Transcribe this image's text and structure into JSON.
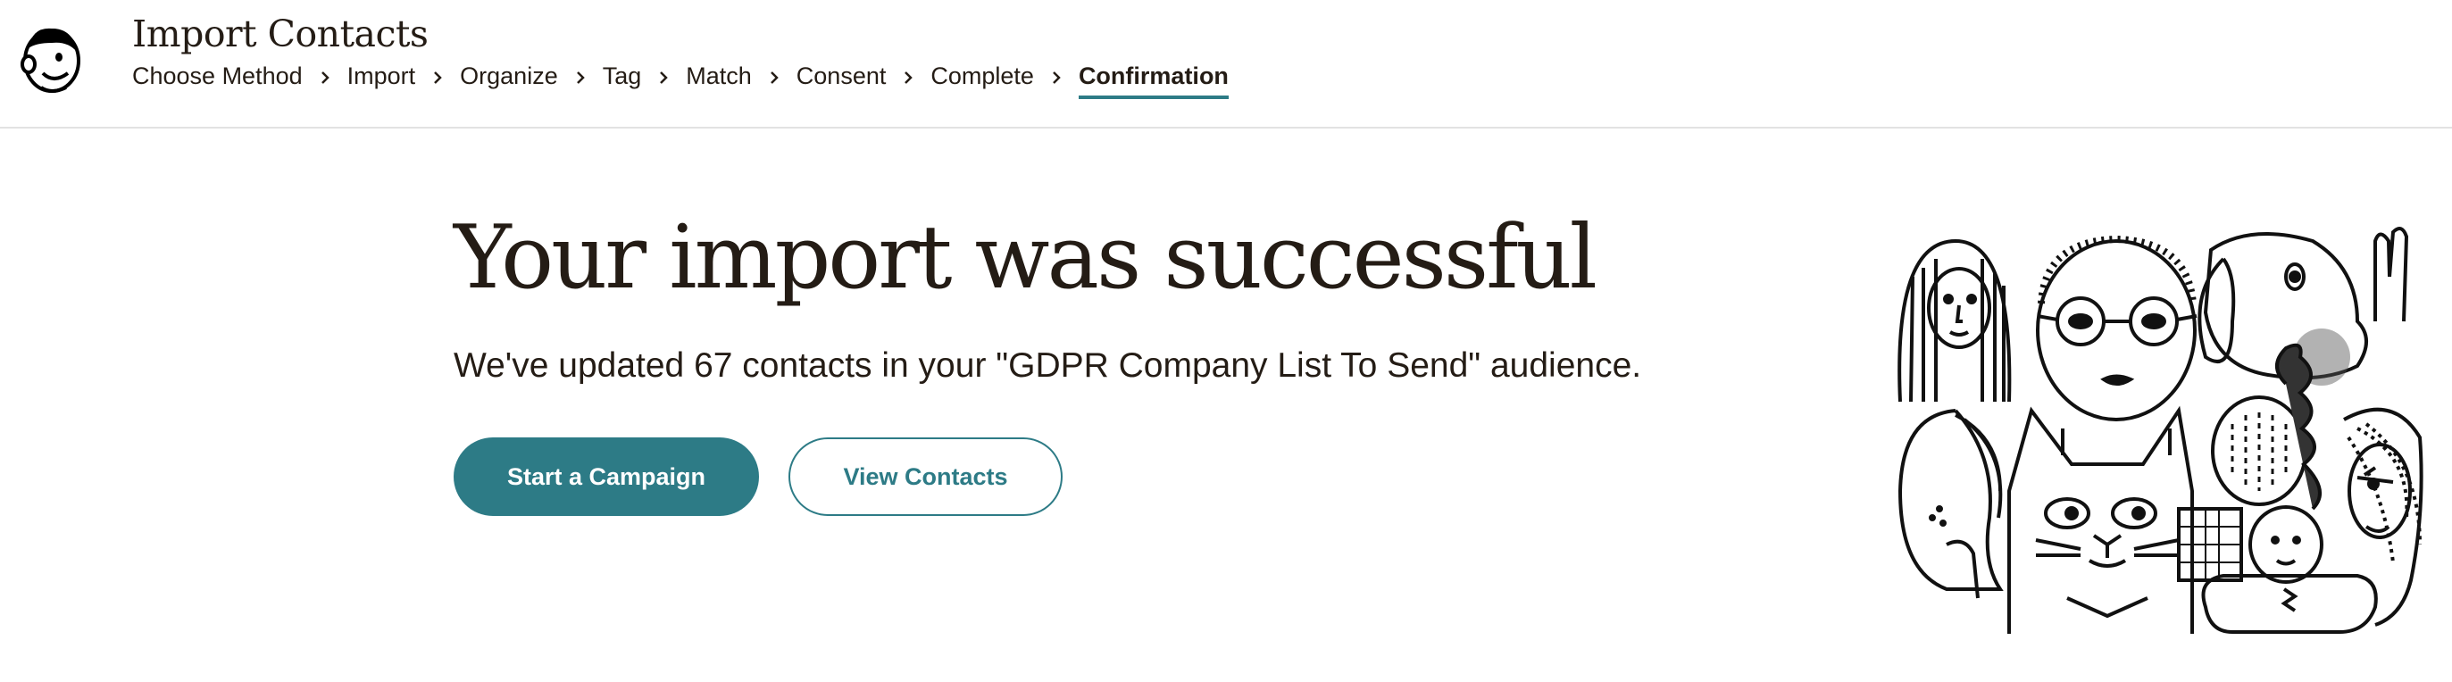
{
  "header": {
    "title": "Import Contacts",
    "logo_icon": "mailchimp-freddie-logo",
    "breadcrumb": [
      {
        "label": "Choose Method",
        "active": false
      },
      {
        "label": "Import",
        "active": false
      },
      {
        "label": "Organize",
        "active": false
      },
      {
        "label": "Tag",
        "active": false
      },
      {
        "label": "Match",
        "active": false
      },
      {
        "label": "Consent",
        "active": false
      },
      {
        "label": "Complete",
        "active": false
      },
      {
        "label": "Confirmation",
        "active": true
      }
    ],
    "separator_icon": "chevron-right-icon"
  },
  "main": {
    "headline": "Your import was successful",
    "message": "We've updated 67 contacts in your \"GDPR Company List To Send\" audience.",
    "primary_button": "Start a Campaign",
    "secondary_button": "View Contacts",
    "illustration_icon": "crowd-of-faces-illustration"
  },
  "colors": {
    "accent": "#2d7b86",
    "text": "#241c15",
    "divider": "#e2e2e2"
  }
}
